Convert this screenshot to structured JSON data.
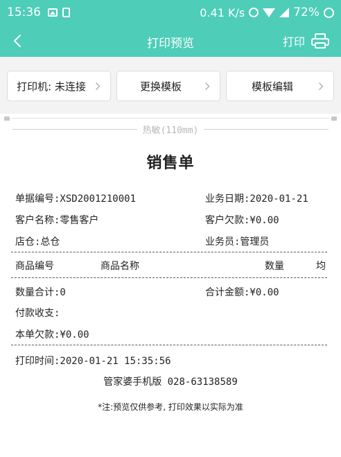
{
  "status_bar": {
    "time": "15:36",
    "network_speed": "0.41 K/s",
    "battery": "72%"
  },
  "header": {
    "title": "打印预览",
    "print_label": "打印"
  },
  "toolbar": {
    "printer_label": "打印机: 未连接",
    "change_template_label": "更换模板",
    "edit_template_label": "模板编辑"
  },
  "paper": {
    "type": "热敏(110mm)"
  },
  "receipt": {
    "title": "销售单",
    "doc_no": "单据编号:XSD2001210001",
    "biz_date": "业务日期:2020-01-21",
    "customer_name": "客户名称:零售客户",
    "customer_debt": "客户欠款:¥0.00",
    "warehouse": "店仓:总仓",
    "salesperson": "业务员:管理员",
    "columns": [
      "商品编号",
      "商品名称",
      "数量",
      "均"
    ],
    "total_qty": "数量合计:0",
    "total_amount": "合计金额:¥0.00",
    "payment": "付款收支:",
    "this_debt": "本单欠款:¥0.00",
    "print_time": "打印时间:2020-01-21 15:35:56",
    "company": "管家婆手机版 028-63138589",
    "note": "*注:预览仅供参考, 打印效果以实际为准"
  }
}
